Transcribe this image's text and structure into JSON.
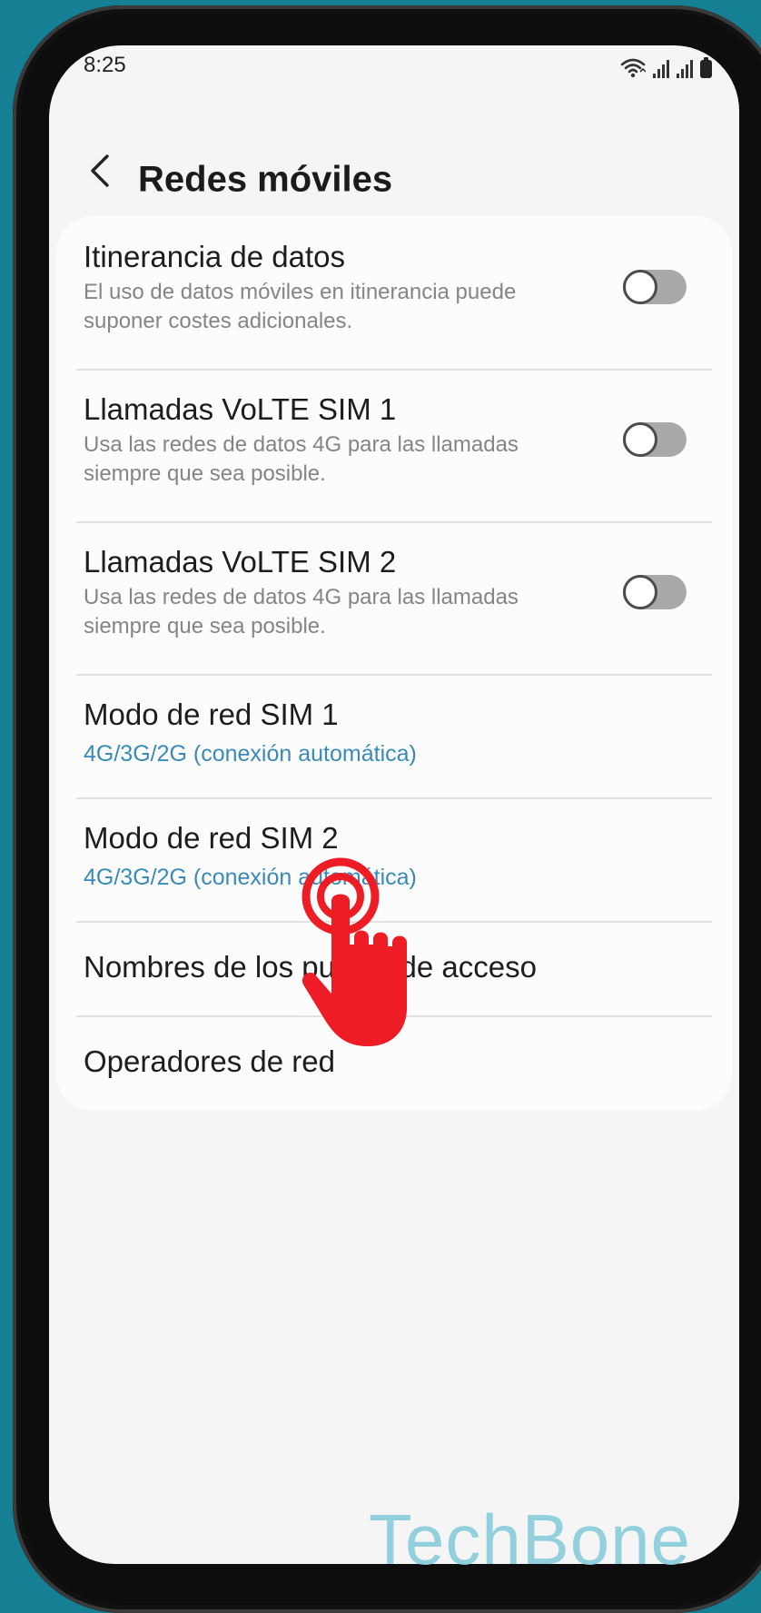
{
  "status_bar": {
    "time": "8:25"
  },
  "header": {
    "title": "Redes móviles",
    "back_icon": "chevron-left-icon"
  },
  "settings": [
    {
      "title": "Itinerancia de datos",
      "subtitle": "El uso de datos móviles en itinerancia puede suponer costes adicionales.",
      "toggle_on": false
    },
    {
      "title": "Llamadas VoLTE SIM 1",
      "subtitle": "Usa las redes de datos 4G para las llamadas siempre que sea posible.",
      "toggle_on": false
    },
    {
      "title": "Llamadas VoLTE SIM 2",
      "subtitle": "Usa las redes de datos 4G para las llamadas siempre que sea posible.",
      "toggle_on": false
    },
    {
      "title": "Modo de red SIM 1",
      "value": "4G/3G/2G (conexión automática)"
    },
    {
      "title": "Modo de red SIM 2",
      "value": "4G/3G/2G (conexión automática)"
    },
    {
      "title": "Nombres de los puntos de acceso"
    },
    {
      "title": "Operadores de red"
    }
  ],
  "overlay": {
    "touch_indicator_icon": "tap-hand-icon"
  },
  "watermark": "TechBone",
  "colors": {
    "background": "#157f93",
    "screen": "#f5f5f5",
    "card": "#fcfcfc",
    "value_text": "#3a8ab8",
    "touch_indicator": "#ee1c25",
    "watermark": "#8dcfdc"
  }
}
